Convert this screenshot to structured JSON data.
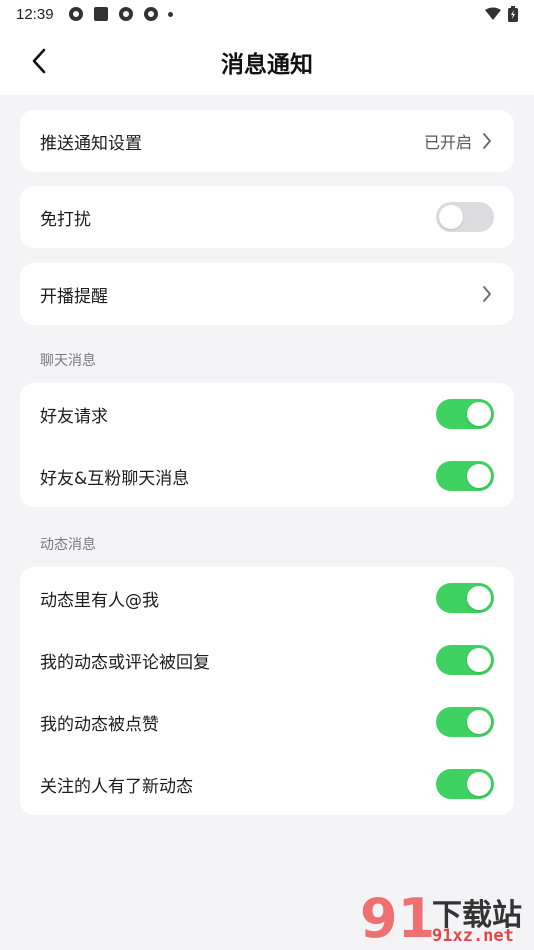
{
  "status_bar": {
    "time": "12:39",
    "icons": [
      "app-icon",
      "square-icon",
      "app-icon",
      "app-icon",
      "dot-icon"
    ],
    "right_icons": [
      "wifi-icon",
      "battery-icon"
    ]
  },
  "header": {
    "title": "消息通知",
    "back_icon": "chevron-left-icon"
  },
  "push": {
    "label": "推送通知设置",
    "value": "已开启"
  },
  "dnd": {
    "label": "免打扰",
    "on": false
  },
  "live": {
    "label": "开播提醒"
  },
  "chat_section": {
    "title": "聊天消息",
    "items": [
      {
        "label": "好友请求",
        "on": true
      },
      {
        "label": "好友&互粉聊天消息",
        "on": true
      }
    ]
  },
  "feed_section": {
    "title": "动态消息",
    "items": [
      {
        "label": "动态里有人@我",
        "on": true
      },
      {
        "label": "我的动态或评论被回复",
        "on": true
      },
      {
        "label": "我的动态被点赞",
        "on": true
      },
      {
        "label": "关注的人有了新动态",
        "on": true
      }
    ]
  },
  "watermark": {
    "number": "91",
    "title": "下载站",
    "site": "91xz.net"
  },
  "colors": {
    "toggle_on": "#3fd162",
    "toggle_off": "#dcdcde",
    "background": "#f4f4f6"
  }
}
